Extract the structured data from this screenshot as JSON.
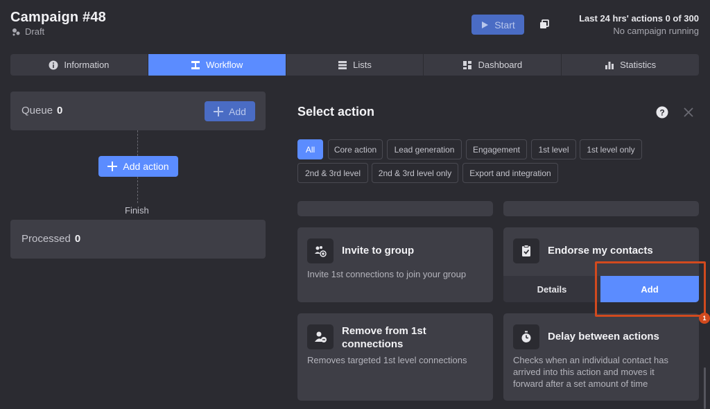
{
  "header": {
    "title": "Campaign #48",
    "status": "Draft",
    "start_label": "Start",
    "actions_summary": "Last 24 hrs' actions 0 of 300",
    "running_status": "No campaign running"
  },
  "tabs": [
    {
      "label": "Information",
      "icon": "info-icon",
      "active": false
    },
    {
      "label": "Workflow",
      "icon": "workflow-icon",
      "active": true
    },
    {
      "label": "Lists",
      "icon": "list-icon",
      "active": false
    },
    {
      "label": "Dashboard",
      "icon": "dashboard-icon",
      "active": false
    },
    {
      "label": "Statistics",
      "icon": "bar-chart-icon",
      "active": false
    }
  ],
  "workflow": {
    "queue_label": "Queue",
    "queue_count": "0",
    "queue_add_label": "Add",
    "add_action_label": "Add action",
    "finish_label": "Finish",
    "processed_label": "Processed",
    "processed_count": "0"
  },
  "select_action": {
    "title": "Select action",
    "filters": [
      "All",
      "Core action",
      "Lead generation",
      "Engagement",
      "1st level",
      "1st level only",
      "2nd & 3rd level",
      "2nd & 3rd level only",
      "Export and integration"
    ],
    "active_filter": "All"
  },
  "cards": {
    "invite": {
      "title": "Invite to group",
      "desc": "Invite 1st connections to join your group",
      "icon": "group-add-icon"
    },
    "endorse": {
      "title": "Endorse my contacts",
      "details_label": "Details",
      "add_label": "Add",
      "icon": "clipboard-check-icon"
    },
    "remove": {
      "title_line1": "Remove from 1st",
      "title_line2": "connections",
      "desc": "Removes targeted 1st level connections",
      "icon": "user-remove-icon"
    },
    "delay": {
      "title": "Delay between actions",
      "desc_line1": "Checks when an individual contact has",
      "desc_line2": "arrived into this action and moves it",
      "desc_line3": "forward after a set amount of time",
      "icon": "stopwatch-icon"
    }
  },
  "annotation": {
    "badge": "1",
    "color": "#d24a1e"
  },
  "colors": {
    "accent": "#5b8cff",
    "accent_dim": "#4a6cc4",
    "bg": "#2b2b31",
    "card": "#3e3e46"
  }
}
